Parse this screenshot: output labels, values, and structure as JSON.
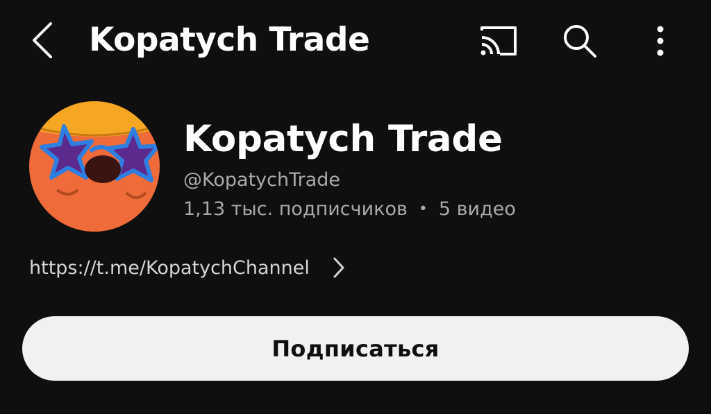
{
  "header": {
    "title": "Kopatych Trade",
    "back_icon": "chevron-left-icon",
    "cast_icon": "cast-icon",
    "search_icon": "search-icon",
    "more_icon": "more-vertical-icon"
  },
  "channel": {
    "name": "Kopatych Trade",
    "handle": "@KopatychTrade",
    "subscribers": "1,13 тыс. подписчиков",
    "separator": "•",
    "videos": "5 видео",
    "link": "https://t.me/KopatychChannel",
    "link_icon": "chevron-right-icon"
  },
  "actions": {
    "subscribe_label": "Подписаться"
  },
  "colors": {
    "background": "#0f0f0f",
    "text_primary": "#ffffff",
    "text_secondary": "#aaaaaa",
    "button_bg": "#f1f1f1",
    "avatar_orange": "#ef6b3a",
    "avatar_hat": "#f5a623",
    "avatar_glasses": "#5b2a8c"
  }
}
